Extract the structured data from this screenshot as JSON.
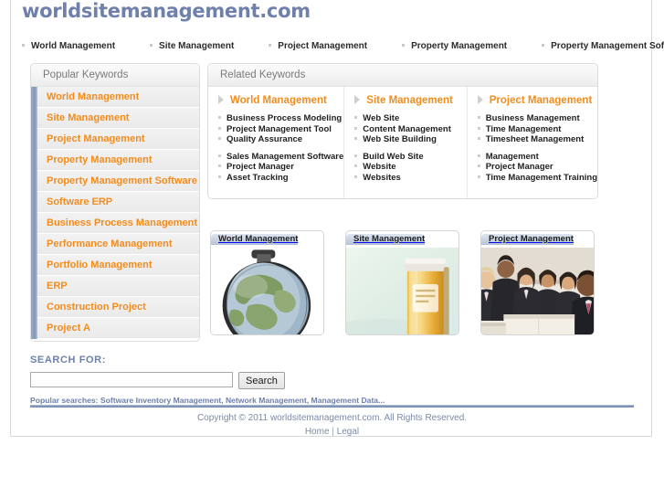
{
  "site": {
    "title": "worldsitemanagement.com",
    "accent_orange": "#f28c1c",
    "accent_blue": "#6e80ab"
  },
  "topnav": {
    "items": [
      {
        "label": "World Management"
      },
      {
        "label": "Site Management"
      },
      {
        "label": "Project Management"
      },
      {
        "label": "Property Management"
      },
      {
        "label": "Property Management Software"
      }
    ]
  },
  "sidebar": {
    "header": "Popular Keywords",
    "items": [
      {
        "label": "World Management"
      },
      {
        "label": "Site Management"
      },
      {
        "label": "Project Management"
      },
      {
        "label": "Property Management"
      },
      {
        "label": "Property Management Software"
      },
      {
        "label": "Software ERP"
      },
      {
        "label": "Business Process Management"
      },
      {
        "label": "Performance Management"
      },
      {
        "label": "Portfolio Management"
      },
      {
        "label": "ERP"
      },
      {
        "label": "Construction Project"
      },
      {
        "label": "Project A"
      }
    ]
  },
  "related": {
    "header": "Related Keywords",
    "columns": [
      {
        "heading": "World Management",
        "groups": [
          [
            "Business Process Modeling",
            "Project Management Tool",
            "Quality Assurance"
          ],
          [
            "Sales Management Software",
            "Project Manager",
            "Asset Tracking"
          ]
        ]
      },
      {
        "heading": "Site Management",
        "groups": [
          [
            "Web Site",
            "Content Management",
            "Web Site Building"
          ],
          [
            "Build Web Site",
            "Website",
            "Websites"
          ]
        ]
      },
      {
        "heading": "Project Management",
        "groups": [
          [
            "Business Management",
            "Time Management",
            "Timesheet Management"
          ],
          [
            "Management",
            "Project Manager",
            "Time Management Training"
          ]
        ]
      }
    ]
  },
  "thumbnails": [
    {
      "caption": "World Management",
      "art": "globe-image"
    },
    {
      "caption": "Site Management",
      "art": "capsule-image"
    },
    {
      "caption": "Project Management",
      "art": "business-people-image"
    }
  ],
  "search": {
    "label": "SEARCH FOR:",
    "value": "",
    "placeholder": "",
    "button_label": "Search",
    "popular": "Popular searches: Software Inventory Management, Network Management, Management Data..."
  },
  "footer": {
    "copyright": "Copyright © 2011 worldsitemanagement.com. All Rights Reserved.",
    "home_label": "Home",
    "separator": "|",
    "legal_label": "Legal"
  }
}
